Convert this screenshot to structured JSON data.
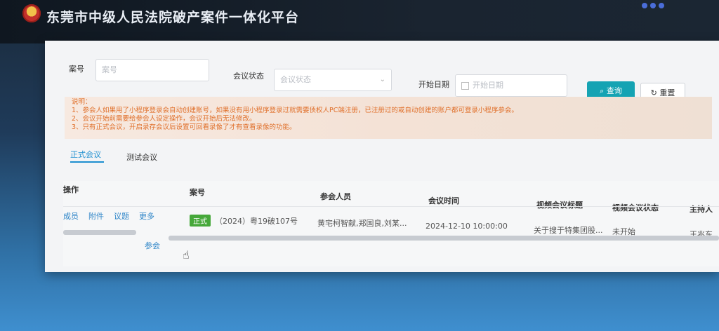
{
  "header": {
    "title": "东莞市中级人民法院破产案件一体化平台"
  },
  "filters": {
    "case_no": {
      "label": "案号",
      "placeholder": "案号"
    },
    "meeting_status": {
      "label": "会议状态",
      "placeholder": "会议状态"
    },
    "start_date": {
      "label": "开始日期",
      "placeholder": "开始日期"
    },
    "query_label": "查询",
    "reset_label": "重置"
  },
  "notice": {
    "title": "说明：",
    "lines": [
      "1、参会人如果用了小程序登录会自动创建账号，如果没有用小程序登录过就需要债权人PC端注册，已注册过的或自动创建的账户都可登录小程序参会。",
      "2、会议开始前需要给参会人设定操作，会议开始后无法修改。",
      "3、只有正式会议，开启录存会议后设置可回看录像了才有查看录像的功能。"
    ]
  },
  "tabs": {
    "formal": "正式会议",
    "test": "测试会议"
  },
  "table": {
    "headers": {
      "actions": "操作",
      "case_no": "案号",
      "participants": "参会人员",
      "meeting_time": "会议时间",
      "video_title": "视频会议标题",
      "video_status": "视频会议状态",
      "host": "主持人"
    },
    "rows": [
      {
        "actions": {
          "members": "成员",
          "attachments": "附件",
          "agenda": "议题",
          "more": "更多",
          "join": "参会"
        },
        "tag": "正式",
        "case_no": "（2024）粤19破107号",
        "participants": "黄宅柯智献,郑国良,刘某...",
        "meeting_time": "2024-12-10 10:00:00",
        "video_title": "关于搜于特集团股...",
        "video_status": "未开始",
        "host": "王兆东"
      }
    ]
  },
  "colors": {
    "accent": "#15a3b3",
    "link": "#2f86c8",
    "notice_text": "#e0702b",
    "tag_formal": "#46a83a"
  }
}
